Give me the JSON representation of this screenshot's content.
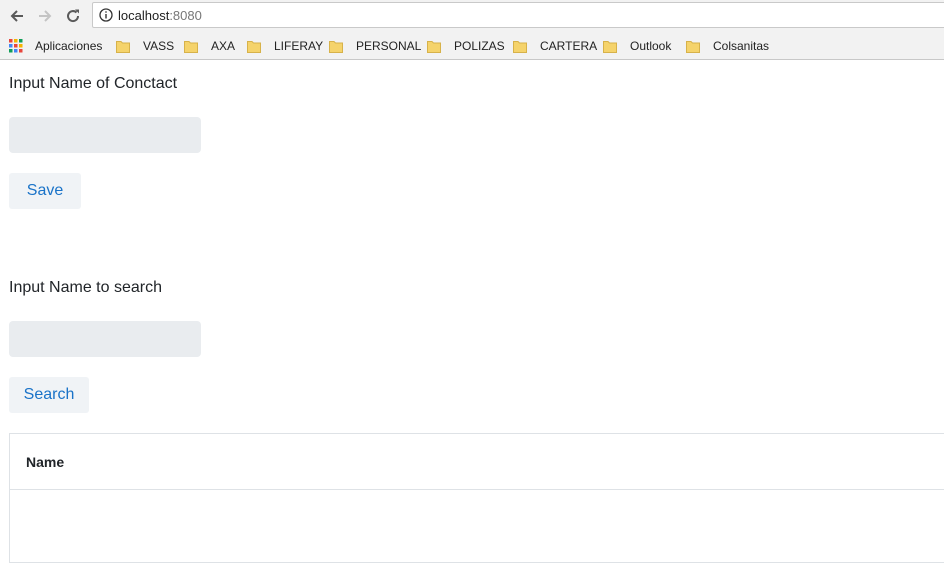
{
  "browser": {
    "url_host": "localhost",
    "url_port": ":8080",
    "bookmarks": [
      {
        "label": "Aplicaciones",
        "icon": "apps-grid-icon"
      },
      {
        "label": "VASS",
        "icon": "folder-icon"
      },
      {
        "label": "AXA",
        "icon": "folder-icon"
      },
      {
        "label": "LIFERAY",
        "icon": "folder-icon"
      },
      {
        "label": "PERSONAL",
        "icon": "folder-icon"
      },
      {
        "label": "POLIZAS",
        "icon": "folder-icon"
      },
      {
        "label": "CARTERA",
        "icon": "folder-icon"
      },
      {
        "label": "Outlook",
        "icon": "folder-icon"
      },
      {
        "label": "Colsanitas",
        "icon": "folder-icon"
      }
    ]
  },
  "form": {
    "contact_label": "Input Name of Conctact",
    "contact_value": "",
    "save_label": "Save",
    "search_label": "Input Name to search",
    "search_value": "",
    "search_button_label": "Search"
  },
  "table": {
    "headers": [
      "Name"
    ],
    "rows": []
  },
  "colors": {
    "button_text": "#1a73c8",
    "input_bg": "#e9ecef",
    "button_bg": "#f0f3f6",
    "folder": "#f5d36b"
  }
}
